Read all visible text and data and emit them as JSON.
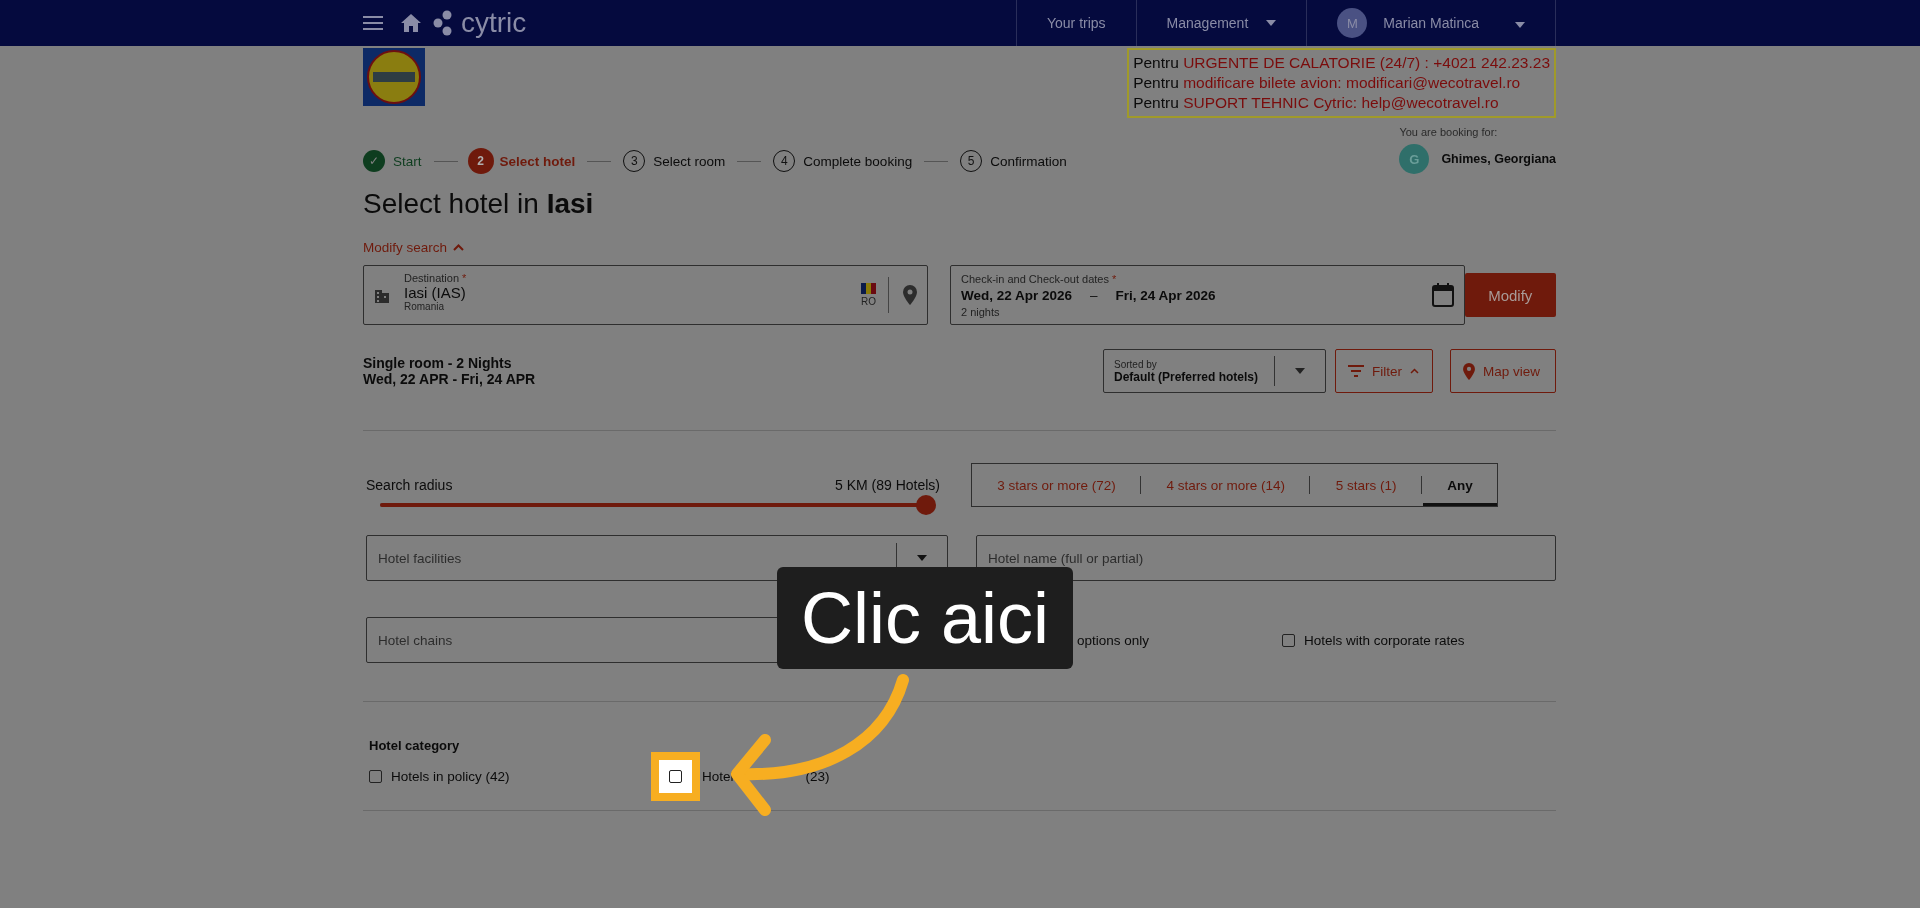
{
  "header": {
    "brand": "cytric",
    "nav": [
      {
        "label": "Your trips",
        "dropdown": false
      },
      {
        "label": "Management",
        "dropdown": true
      }
    ],
    "user": {
      "initial": "M",
      "name": "Marian Matinca"
    }
  },
  "contact": [
    {
      "prefix": "Pentru",
      "label": "URGENTE DE CALATORIE (24/7) :",
      "value": "+4021 242.23.23"
    },
    {
      "prefix": "Pentru",
      "label": "modificare bilete avion:",
      "value": "modificari@wecotravel.ro"
    },
    {
      "prefix": "Pentru",
      "label": "SUPORT TEHNIC Cytric:",
      "value": "help@wecotravel.ro"
    }
  ],
  "steps": [
    {
      "marker": "✓",
      "label": "Start",
      "done": true,
      "selected": false
    },
    {
      "marker": "2",
      "label": "Select hotel",
      "done": false,
      "selected": true
    },
    {
      "marker": "3",
      "label": "Select room",
      "done": false,
      "selected": false
    },
    {
      "marker": "4",
      "label": "Complete booking",
      "done": false,
      "selected": false
    },
    {
      "marker": "5",
      "label": "Confirmation",
      "done": false,
      "selected": false
    }
  ],
  "booking_for": {
    "label": "You are booking for:",
    "initial": "G",
    "name": "Ghimes, Georgiana"
  },
  "title": "Select hotel in **Iasi**",
  "modify_search": "Modify search",
  "destination": {
    "label": "Destination",
    "required": "*",
    "value": "Iasi (IAS)",
    "sub": "Romania",
    "country": "RO"
  },
  "dates": {
    "label": "Check-in and Check-out dates",
    "required": "*",
    "checkin": "Wed, 22 Apr 2026",
    "dash": "–",
    "checkout": "Fri, 24 Apr 2026",
    "nights": "2 nights"
  },
  "modify_button": "Modify",
  "summary": {
    "room": "Single room - 2 Nights",
    "dates": "Wed, 22 APR - Fri, 24 APR"
  },
  "sort": {
    "label": "Sorted by",
    "value": "Default (Preferred hotels)"
  },
  "filter_button": "Filter",
  "map_button": "Map view",
  "radius": {
    "label": "Search radius",
    "reading": "5 KM (89 Hotels)",
    "level": 1
  },
  "star_tabs": [
    {
      "label": "3 stars or more (72)",
      "selected": false
    },
    {
      "label": "4 stars or more (14)",
      "selected": false
    },
    {
      "label": "5 stars (1)",
      "selected": false
    },
    {
      "label": "Any",
      "selected": true
    }
  ],
  "facilities": {
    "placeholder": "Hotel facilities"
  },
  "hotel_name": {
    "placeholder": "Hotel name (full or partial)"
  },
  "chains": {
    "placeholder": "Hotel chains"
  },
  "options": [
    {
      "label": "options only"
    },
    {
      "label": "Hotels with corporate rates",
      "checked": false
    }
  ],
  "category": {
    "title": "Hotel category",
    "items": [
      {
        "label": "Hotels in policy (42)",
        "checked": false,
        "highlighted": false
      },
      {
        "label": "Hotel",
        "label_end": "(23)",
        "checked": false,
        "highlighted": true
      }
    ]
  },
  "callout": "Clic aici"
}
